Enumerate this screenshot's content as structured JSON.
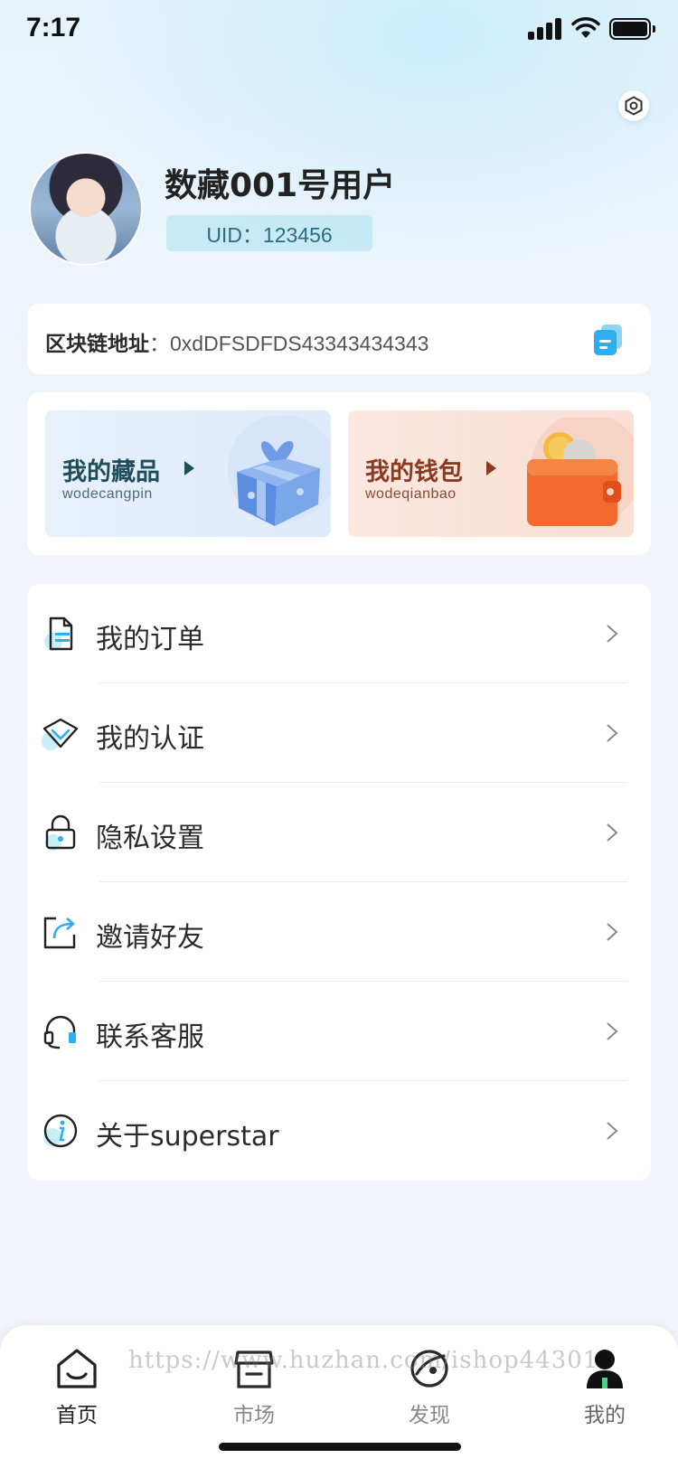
{
  "status_bar": {
    "time": "7:17"
  },
  "profile": {
    "user_name": "数藏001号用户",
    "uid": "UID：123456"
  },
  "address": {
    "label": "区块链地址",
    "separator": "：",
    "value": "0xdDFSDFDS43343434343"
  },
  "assets": {
    "collection": {
      "title": "我的藏品",
      "subtitle": "wodecangpin"
    },
    "wallet": {
      "title": "我的钱包",
      "subtitle": "wodeqianbao"
    }
  },
  "menu": [
    {
      "label": "我的订单",
      "icon": "order-icon"
    },
    {
      "label": "我的认证",
      "icon": "certification-icon"
    },
    {
      "label": "隐私设置",
      "icon": "lock-icon"
    },
    {
      "label": "邀请好友",
      "icon": "share-icon"
    },
    {
      "label": "联系客服",
      "icon": "headset-icon"
    },
    {
      "label": "关于superstar",
      "icon": "info-icon"
    }
  ],
  "tabs": [
    {
      "label": "首页",
      "icon": "home-icon"
    },
    {
      "label": "市场",
      "icon": "market-icon"
    },
    {
      "label": "发现",
      "icon": "discover-icon"
    },
    {
      "label": "我的",
      "icon": "user-icon",
      "active": true
    }
  ],
  "watermark": "https://www.huzhan.com/ishop44301",
  "colors": {
    "accent_blue": "#2eaef0",
    "collection_text": "#1f4d5a",
    "wallet_text": "#8b3a22",
    "wallet_orange": "#f26a2e"
  }
}
